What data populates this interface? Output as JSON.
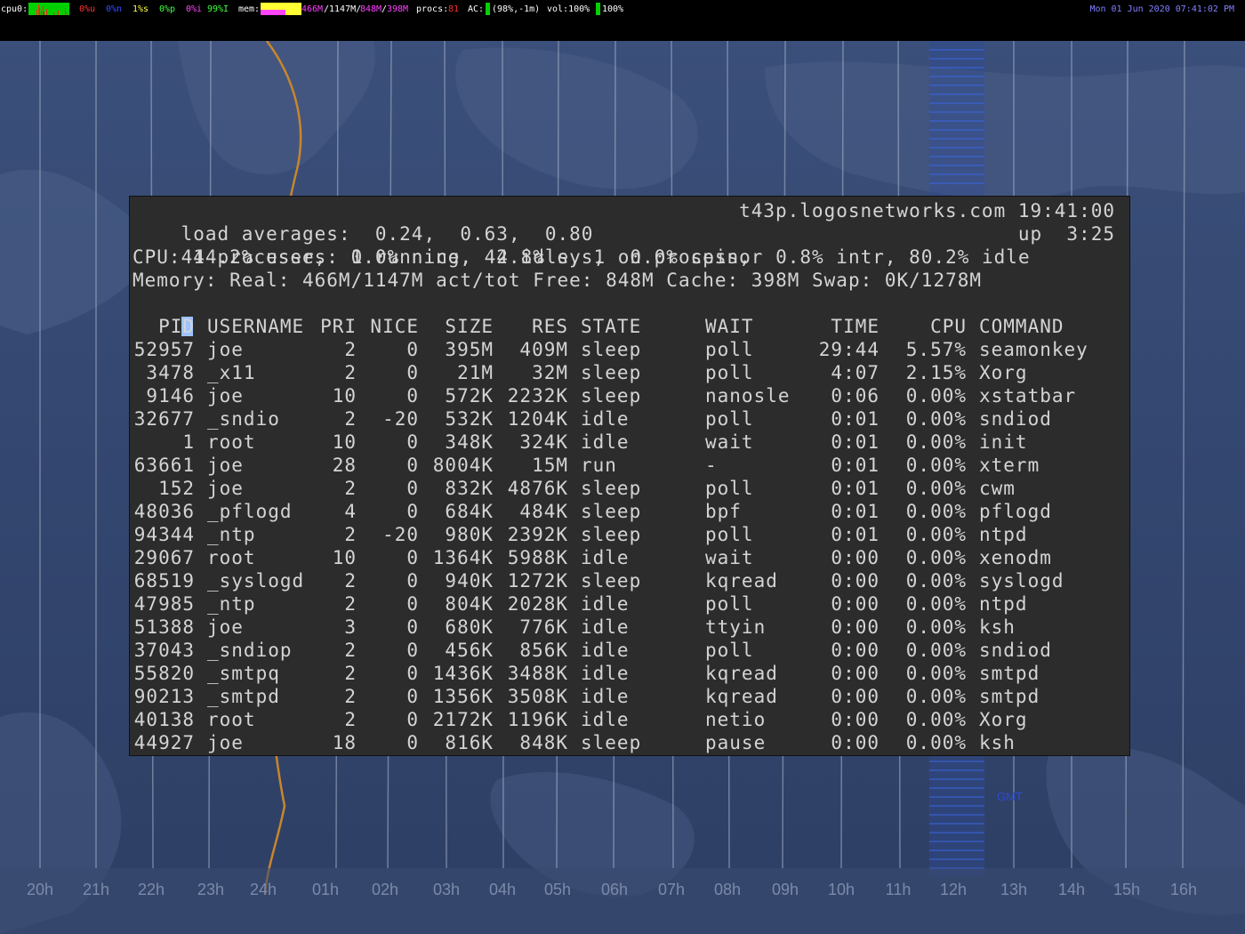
{
  "statusbar": {
    "cpu_label": "cpu0:",
    "cpu_user": "0%u",
    "cpu_nice": "0%n",
    "cpu_sys": "1%s",
    "cpu_spin": "0%p",
    "cpu_intr": "0%i",
    "cpu_idle": "99%I",
    "mem_label": "mem:",
    "mem_active": "466M",
    "mem_total": "/1147M/",
    "mem_free": "848M",
    "mem_sep": "/",
    "mem_cache": "398M",
    "procs_label": "procs:",
    "procs_value": "81",
    "ac_label": "AC:",
    "ac_value": "(98%,-1m)",
    "vol_label": "vol:100%",
    "vol_value": "100%",
    "datetime": "Mon 01 Jun 2020 07:41:02 PM",
    "colors": {
      "cpu_user": "#ff3030",
      "cpu_nice": "#3050ff",
      "cpu_sys": "#ffff40",
      "cpu_spin": "#40ff40",
      "cpu_intr": "#ff40ff",
      "cpu_idle": "#40ff40",
      "mem_active": "#ff40ff",
      "mem_free": "#ff40ff",
      "mem_cache": "#ff40ff",
      "procs_value": "#ff3030",
      "default": "#ffffff",
      "datetime": "#8080ff"
    }
  },
  "wallpaper": {
    "hours": [
      "20h",
      "21h",
      "22h",
      "23h",
      "24h",
      "01h",
      "02h",
      "03h",
      "04h",
      "05h",
      "06h",
      "07h",
      "08h",
      "09h",
      "10h",
      "11h",
      "12h",
      "13h",
      "14h",
      "15h",
      "16h"
    ],
    "logo_icon": "ibm-logo-icon",
    "label_gmt": "GMT"
  },
  "terminal": {
    "summary": {
      "load": "load averages:  0.24,  0.63,  0.80",
      "host_time": "t43p.logosnetworks.com 19:41:00",
      "processes": "44 processes: 1 running, 42 idle, 1 on processor",
      "uptime": "up  3:25",
      "cpu": "CPU: 14.2% user,  0.0% nice,  4.8% sys,  0.0% spin,  0.8% intr, 80.2% idle",
      "memory": "Memory: Real: 466M/1147M act/tot Free: 848M Cache: 398M Swap: 0K/1278M"
    },
    "columns": [
      "PID",
      "USERNAME",
      "PRI",
      "NICE",
      "SIZE",
      "RES",
      "STATE",
      "WAIT",
      "TIME",
      "CPU",
      "COMMAND"
    ],
    "rows": [
      [
        "52957",
        "joe",
        "2",
        "0",
        "395M",
        "409M",
        "sleep",
        "poll",
        "29:44",
        "5.57%",
        "seamonkey"
      ],
      [
        "3478",
        "_x11",
        "2",
        "0",
        "21M",
        "32M",
        "sleep",
        "poll",
        "4:07",
        "2.15%",
        "Xorg"
      ],
      [
        "9146",
        "joe",
        "10",
        "0",
        "572K",
        "2232K",
        "sleep",
        "nanosle",
        "0:06",
        "0.00%",
        "xstatbar"
      ],
      [
        "32677",
        "_sndio",
        "2",
        "-20",
        "532K",
        "1204K",
        "idle",
        "poll",
        "0:01",
        "0.00%",
        "sndiod"
      ],
      [
        "1",
        "root",
        "10",
        "0",
        "348K",
        "324K",
        "idle",
        "wait",
        "0:01",
        "0.00%",
        "init"
      ],
      [
        "63661",
        "joe",
        "28",
        "0",
        "8004K",
        "15M",
        "run",
        "-",
        "0:01",
        "0.00%",
        "xterm"
      ],
      [
        "152",
        "joe",
        "2",
        "0",
        "832K",
        "4876K",
        "sleep",
        "poll",
        "0:01",
        "0.00%",
        "cwm"
      ],
      [
        "48036",
        "_pflogd",
        "4",
        "0",
        "684K",
        "484K",
        "sleep",
        "bpf",
        "0:01",
        "0.00%",
        "pflogd"
      ],
      [
        "94344",
        "_ntp",
        "2",
        "-20",
        "980K",
        "2392K",
        "sleep",
        "poll",
        "0:01",
        "0.00%",
        "ntpd"
      ],
      [
        "29067",
        "root",
        "10",
        "0",
        "1364K",
        "5988K",
        "idle",
        "wait",
        "0:00",
        "0.00%",
        "xenodm"
      ],
      [
        "68519",
        "_syslogd",
        "2",
        "0",
        "940K",
        "1272K",
        "sleep",
        "kqread",
        "0:00",
        "0.00%",
        "syslogd"
      ],
      [
        "47985",
        "_ntp",
        "2",
        "0",
        "804K",
        "2028K",
        "idle",
        "poll",
        "0:00",
        "0.00%",
        "ntpd"
      ],
      [
        "51388",
        "joe",
        "3",
        "0",
        "680K",
        "776K",
        "idle",
        "ttyin",
        "0:00",
        "0.00%",
        "ksh"
      ],
      [
        "37043",
        "_sndiop",
        "2",
        "0",
        "456K",
        "856K",
        "idle",
        "poll",
        "0:00",
        "0.00%",
        "sndiod"
      ],
      [
        "55820",
        "_smtpq",
        "2",
        "0",
        "1436K",
        "3488K",
        "idle",
        "kqread",
        "0:00",
        "0.00%",
        "smtpd"
      ],
      [
        "90213",
        "_smtpd",
        "2",
        "0",
        "1356K",
        "3508K",
        "idle",
        "kqread",
        "0:00",
        "0.00%",
        "smtpd"
      ],
      [
        "40138",
        "root",
        "2",
        "0",
        "2172K",
        "1196K",
        "idle",
        "netio",
        "0:00",
        "0.00%",
        "Xorg"
      ],
      [
        "44927",
        "joe",
        "18",
        "0",
        "816K",
        "848K",
        "sleep",
        "pause",
        "0:00",
        "0.00%",
        "ksh"
      ]
    ]
  }
}
